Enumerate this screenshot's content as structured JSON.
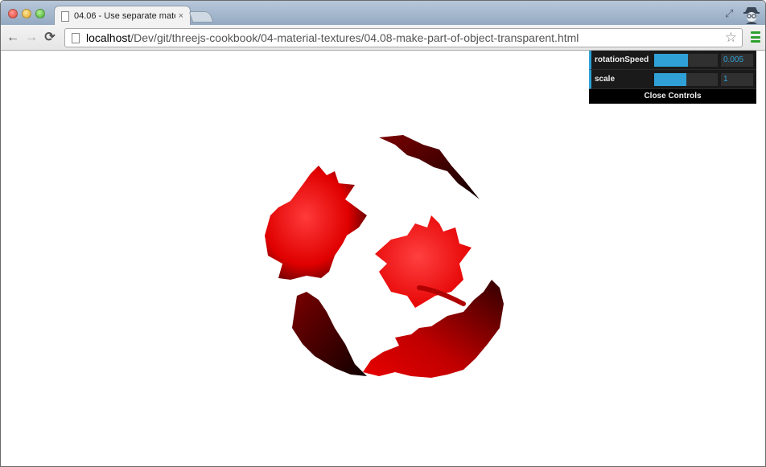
{
  "browser": {
    "tab_title": "04.06 - Use separate mate",
    "tab_close": "×",
    "url_host": "localhost",
    "url_path": "/Dev/git/threejs-cookbook/04-material-textures/04.08-make-part-of-object-transparent.html",
    "back_icon": "←",
    "forward_icon": "→",
    "reload_icon": "⟳",
    "star_icon": "☆",
    "fullscreen_icon": "⤢"
  },
  "controls": {
    "rows": [
      {
        "label": "rotationSpeed",
        "value": "0.005",
        "fill": 0.53
      },
      {
        "label": "scale",
        "value": "1",
        "fill": 0.5
      }
    ],
    "close_label": "Close Controls",
    "accent": "#2fa1d6"
  },
  "scene": {
    "object": "sphere-with-maple-leaf-texture",
    "leaf_color": "#ff0000"
  }
}
